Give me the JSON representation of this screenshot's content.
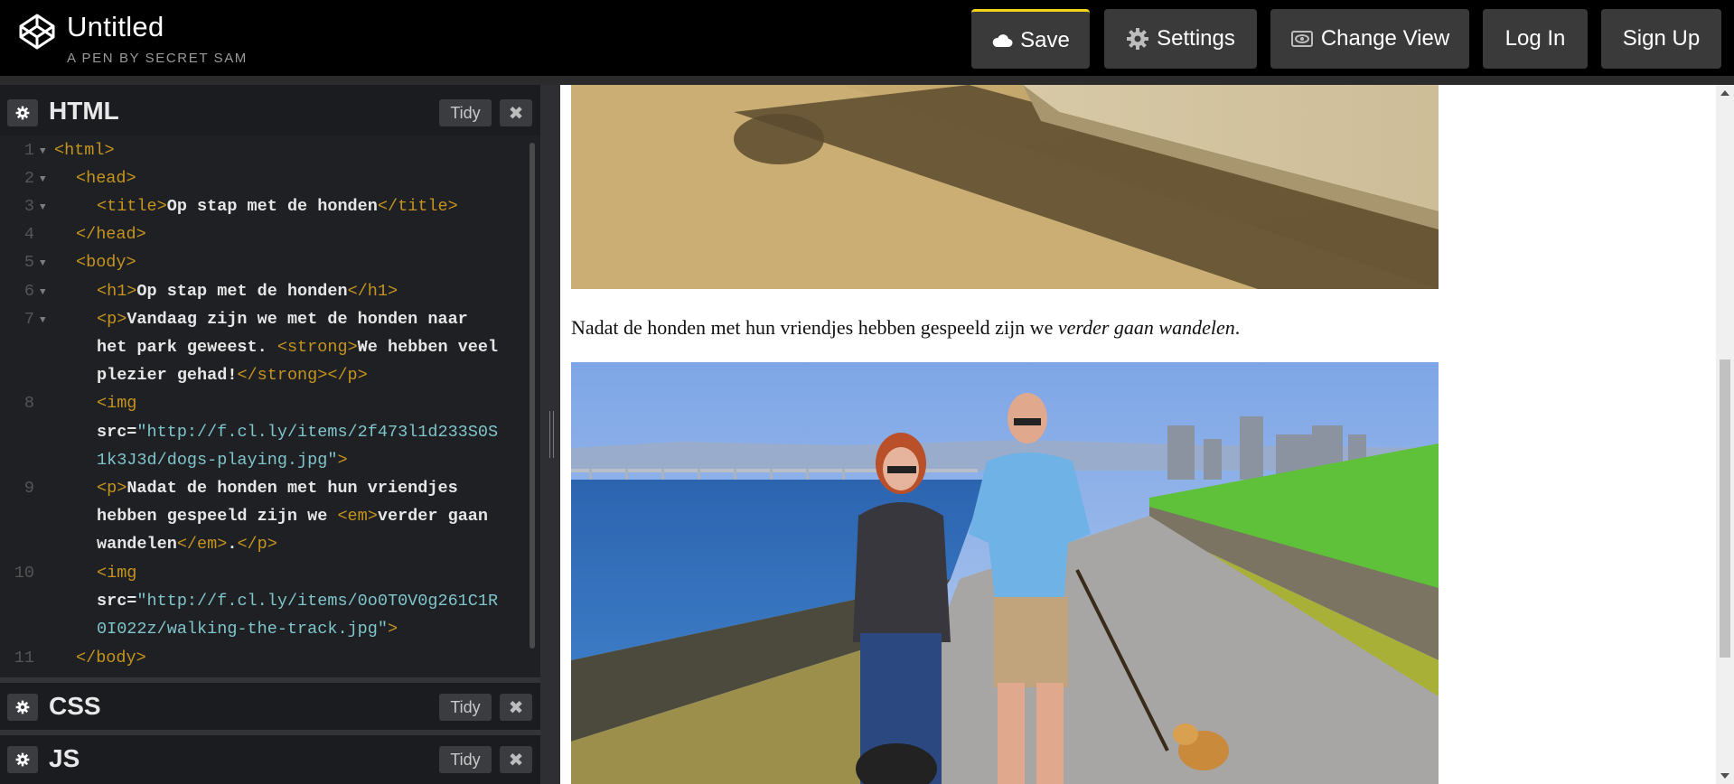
{
  "header": {
    "title": "Untitled",
    "byline": "A PEN BY SECRET SAM",
    "buttons": {
      "save": "Save",
      "settings": "Settings",
      "change_view": "Change View",
      "login": "Log In",
      "signup": "Sign Up"
    }
  },
  "editors": {
    "html": {
      "name": "HTML",
      "tidy": "Tidy",
      "close": "✖"
    },
    "css": {
      "name": "CSS",
      "tidy": "Tidy",
      "close": "✖"
    },
    "js": {
      "name": "JS",
      "tidy": "Tidy",
      "close": "✖"
    }
  },
  "code": {
    "line_numbers": [
      "1",
      "2",
      "3",
      "4",
      "5",
      "6",
      "7",
      "8",
      "9",
      "10",
      "11"
    ],
    "l1_tag": "<html>",
    "l2_tag": "<head>",
    "l3_open": "<title>",
    "l3_text": "Op stap met de honden",
    "l3_close": "</title>",
    "l4_tag": "</head>",
    "l5_tag": "<body>",
    "l6_open": "<h1>",
    "l6_text": "Op stap met de honden",
    "l6_close": "</h1>",
    "l7_open": "<p>",
    "l7_text1": "Vandaag zijn we met de honden naar",
    "l7_text2": "het park geweest. ",
    "l7_strong_open": "<strong>",
    "l7_strong_text1": "We hebben veel",
    "l7_strong_text2": "plezier gehad!",
    "l7_close": "</strong></p>",
    "l8_open": "<img",
    "l8_attr": "src=",
    "l8_val1": "\"http://f.cl.ly/items/2f473l1d233S0S",
    "l8_val2": "1k3J3d/dogs-playing.jpg\"",
    "l8_end": ">",
    "l9_open": "<p>",
    "l9_text1": "Nadat de honden met hun vriendjes",
    "l9_text2": "hebben gespeeld zijn we ",
    "l9_em_open": "<em>",
    "l9_em_text1": "verder gaan",
    "l9_em_text2": "wandelen",
    "l9_em_close": "</em>",
    "l9_dot": ".",
    "l9_close": "</p>",
    "l10_open": "<img",
    "l10_attr": "src=",
    "l10_val1": "\"http://f.cl.ly/items/0o0T0V0g261C1R",
    "l10_val2": "0I022z/walking-the-track.jpg\"",
    "l10_end": ">",
    "l11_tag": "</body>"
  },
  "preview": {
    "caption_text": "Nadat de honden met hun vriendjes hebben gespeeld zijn we ",
    "caption_em": "verder gaan wandelen",
    "caption_end": "."
  },
  "icons": {
    "logo": "codepen-logo-icon",
    "save": "cloud-icon",
    "settings": "gear-icon",
    "change_view": "eye-icon",
    "pane_settings": "gear-icon"
  },
  "colors": {
    "accent_save": "#f2d41b",
    "tag": "#c5941e",
    "string": "#7fc5cc"
  }
}
